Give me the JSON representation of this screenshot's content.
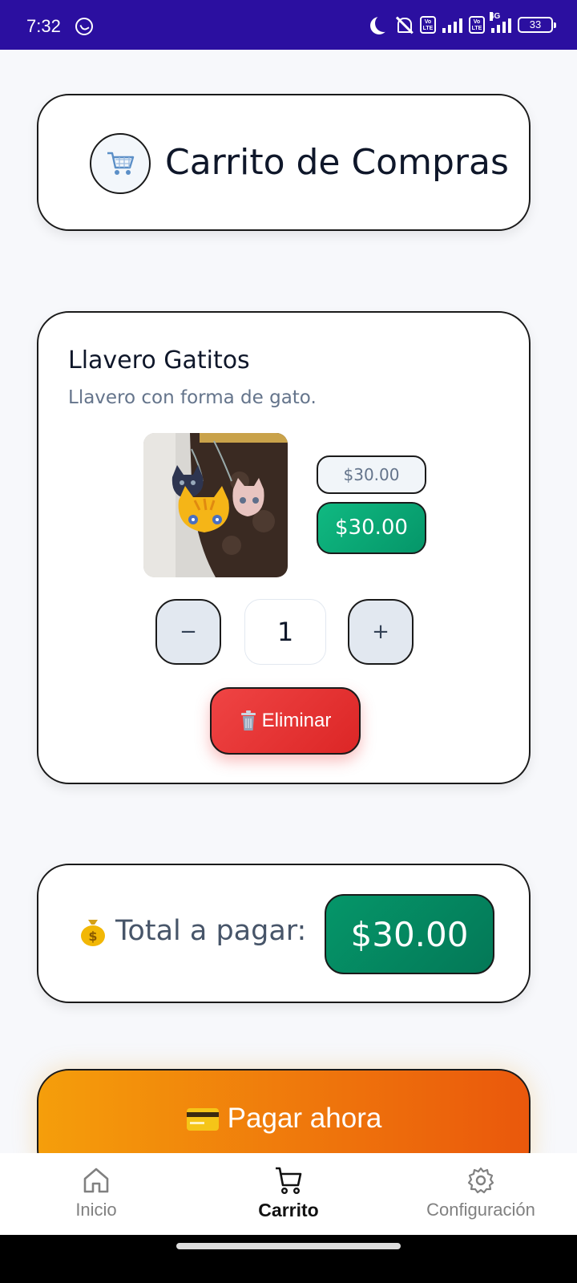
{
  "status_bar": {
    "time": "7:32",
    "network": "4G",
    "volte_label": "Vo LTE",
    "battery": "33"
  },
  "header": {
    "icon": "shopping-cart-icon",
    "title": "Carrito de Compras"
  },
  "product": {
    "name": "Llavero Gatitos",
    "description": "Llavero con forma de gato.",
    "image_alt": "cat keychain photo",
    "price_original": "$30.00",
    "price_current": "$30.00",
    "quantity": "1",
    "minus_label": "−",
    "plus_label": "+",
    "delete_icon": "trash-icon",
    "delete_label": "Eliminar"
  },
  "total": {
    "icon": "money-bag-icon",
    "label": "Total a pagar:",
    "value": "$30.00"
  },
  "pay": {
    "icon": "credit-card-icon",
    "label": "Pagar ahora"
  },
  "nav": {
    "items": [
      {
        "label": "Inicio",
        "icon": "home-icon",
        "active": false
      },
      {
        "label": "Carrito",
        "icon": "cart-icon",
        "active": true
      },
      {
        "label": "Configuración",
        "icon": "gear-icon",
        "active": false
      }
    ]
  },
  "colors": {
    "status_bar": "#2b0fa0",
    "price_green": "#10b981",
    "total_green": "#059669",
    "delete_red": "#ef4444",
    "pay_orange_start": "#f59e0b",
    "pay_orange_end": "#ea580c"
  }
}
